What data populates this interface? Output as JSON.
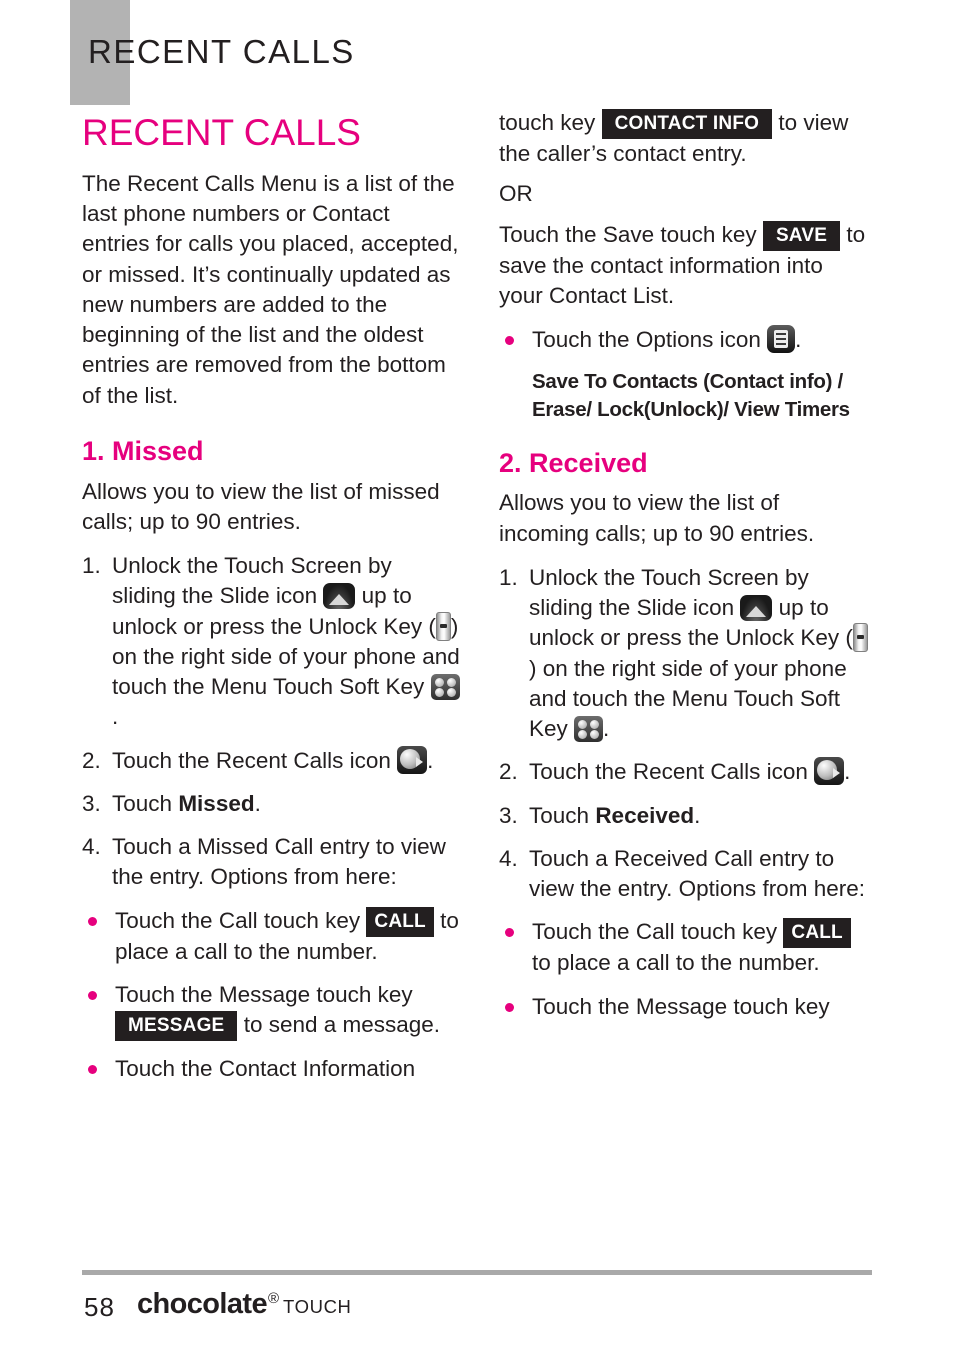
{
  "colors": {
    "accent": "#E6007E",
    "header_band": "#b3b3b3",
    "rule": "#a9a9a9",
    "chip_bg": "#231f20"
  },
  "running_header": {
    "title": "RECENT CALLS"
  },
  "chapter": {
    "title": "RECENT CALLS"
  },
  "intro": "The Recent Calls Menu is a list of the last phone numbers or Contact entries for calls you placed, accepted, or missed. It’s continually updated as new numbers are added to the beginning of the list and the oldest entries are removed from the bottom of the list.",
  "section_missed": {
    "title": "1. Missed",
    "description": "Allows you to view the list of missed calls; up to 90 entries.",
    "steps": [
      {
        "num": "1.",
        "a": "Unlock the Touch Screen by sliding the Slide icon",
        "b": "up to unlock or press the Unlock Key (",
        "c": ") on the right side of your phone and touch the Menu Touch Soft Key",
        "d": "."
      },
      {
        "num": "2.",
        "a": "Touch the Recent Calls icon",
        "b": "."
      },
      {
        "num": "3.",
        "a": "Touch",
        "bold": "Missed",
        "b": "."
      },
      {
        "num": "4.",
        "a": "Touch a Missed Call entry to view the entry. Options from here:"
      }
    ],
    "bullets": [
      {
        "a": "Touch the Call touch key",
        "chip": "CALL",
        "b": "to place a call to the number."
      },
      {
        "a": "Touch the Message touch key",
        "chip": "MESSAGE",
        "b": "to send a message."
      },
      {
        "a": "Touch the Contact Information"
      }
    ]
  },
  "right_column_continuation": {
    "line1_a": "touch key",
    "line1_chip": "CONTACT INFO",
    "line1_b": "to view the caller’s contact entry.",
    "or": "OR",
    "save_a": "Touch the Save touch key",
    "save_chip": "SAVE",
    "save_b": "to save the contact information into your Contact List.",
    "options_bullet_a": "Touch the Options icon",
    "options_bullet_b": ".",
    "options_note": "Save To Contacts (Contact info) / Erase/ Lock(Unlock)/ View Timers"
  },
  "section_received": {
    "title": "2. Received",
    "description": "Allows you to view the list of incoming calls; up to 90 entries.",
    "steps": [
      {
        "num": "1.",
        "a": "Unlock the Touch Screen by sliding the Slide icon",
        "b": "up to unlock or press the Unlock Key (",
        "c": ") on the right side of your phone and touch the Menu Touch Soft Key",
        "d": "."
      },
      {
        "num": "2.",
        "a": "Touch the Recent Calls icon",
        "b": "."
      },
      {
        "num": "3.",
        "a": "Touch",
        "bold": "Received",
        "b": "."
      },
      {
        "num": "4.",
        "a": "Touch a Received Call entry to view the entry. Options from here:"
      }
    ],
    "bullets": [
      {
        "a": "Touch the Call touch key",
        "chip": "CALL",
        "b": "to place a call to the number."
      },
      {
        "a": "Touch the Message touch key"
      }
    ]
  },
  "footer": {
    "page_number": "58",
    "logo_word": "chocolate",
    "logo_reg": "®",
    "logo_touch": "TOUCH"
  },
  "icons": {
    "slide": "slide-icon",
    "unlock_key": "unlock-key-icon",
    "menu_soft_key": "menu-touch-soft-key-icon",
    "recent_calls": "recent-calls-icon",
    "options": "options-icon"
  }
}
